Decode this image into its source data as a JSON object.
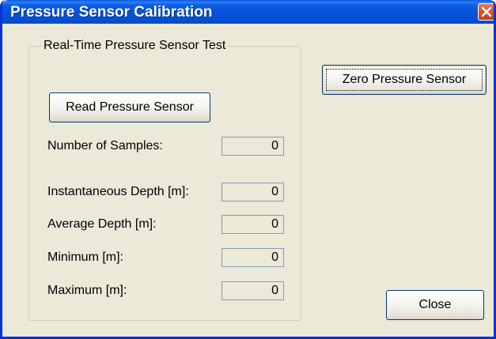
{
  "window": {
    "title": "Pressure Sensor Calibration"
  },
  "group": {
    "legend": "Real-Time Pressure Sensor Test",
    "read_button_label": "Read Pressure Sensor",
    "fields": [
      {
        "label": "Number of Samples:",
        "value": "0"
      },
      {
        "label": "Instantaneous Depth [m]:",
        "value": "0"
      },
      {
        "label": "Average Depth [m]:",
        "value": "0"
      },
      {
        "label": "Minimum [m]:",
        "value": "0"
      },
      {
        "label": "Maximum [m]:",
        "value": "0"
      }
    ]
  },
  "zero_button_label": "Zero Pressure Sensor",
  "close_button_label": "Close",
  "icons": {
    "close": "close-icon"
  },
  "colors": {
    "titlebar": "#0553d8",
    "close_button": "#d8572c",
    "dialog_background": "#ece9d8"
  }
}
